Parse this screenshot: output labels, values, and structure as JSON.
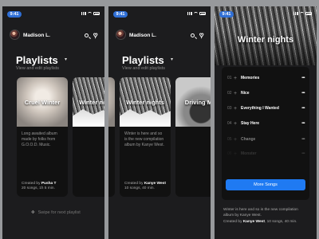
{
  "status": {
    "time": "9:41"
  },
  "user": {
    "name": "Madison L."
  },
  "playlists": {
    "title": "Playlists",
    "subtitle": "View and edit playlists",
    "swipe_hint": "Swipe for next playlist"
  },
  "cards": [
    {
      "title": "Cruel Winter",
      "desc": "Long awaited album made by folks from G.O.O.D. Music.",
      "created_label": "Created by",
      "author": "Pusha T",
      "meta": "20 songs, 1h 5 min."
    },
    {
      "title": "Winter nights",
      "desc": "Winter is here and so is the new compilation album by Kanye West.",
      "created_label": "Created by",
      "author": "Kanye West",
      "meta": "10 songs, 40 min."
    },
    {
      "title": "Driving M...",
      "desc": "",
      "created_label": "",
      "author": "",
      "meta": ""
    }
  ],
  "detail": {
    "title": "Winter nights",
    "songs": [
      {
        "num": "01",
        "title": "Memories"
      },
      {
        "num": "02",
        "title": "Nice"
      },
      {
        "num": "03",
        "title": "Everything I Wanted"
      },
      {
        "num": "04",
        "title": "Stay Here"
      },
      {
        "num": "05",
        "title": "Change"
      },
      {
        "num": "06",
        "title": "Monster"
      }
    ],
    "more_button": "More Songs",
    "desc": "Winter is here and so is the new compilation album by Kanye West.",
    "created_label": "Created by",
    "author": "Kanye West",
    "meta": "10 songs, 40 min."
  }
}
